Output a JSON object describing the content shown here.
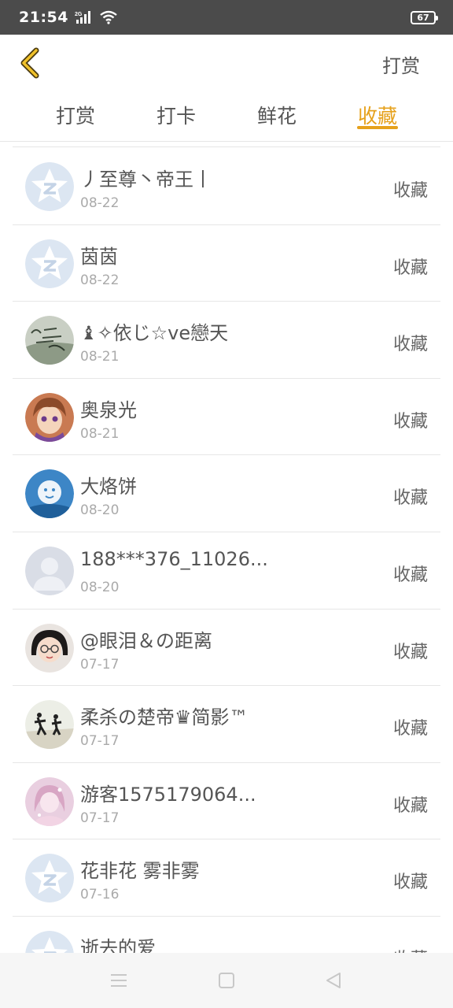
{
  "status_bar": {
    "time": "21:54",
    "network": "2G",
    "battery": "67"
  },
  "header": {
    "back_icon": "chevron-left-icon",
    "action_label": "打赏",
    "accent_color": "#e6a11c"
  },
  "tabs": [
    {
      "label": "打赏",
      "active": false
    },
    {
      "label": "打卡",
      "active": false
    },
    {
      "label": "鲜花",
      "active": false
    },
    {
      "label": "收藏",
      "active": true
    }
  ],
  "rows": [
    {
      "name": "丿至尊丶帝王丨",
      "date": "08-22",
      "action": "收藏",
      "avatar": "default-qq"
    },
    {
      "name": "茵茵",
      "date": "08-22",
      "action": "收藏",
      "avatar": "default-qq"
    },
    {
      "name": "♝✧依じ☆ve戀天",
      "date": "08-21",
      "action": "收藏",
      "avatar": "handwriting"
    },
    {
      "name": "奥泉光",
      "date": "08-21",
      "action": "收藏",
      "avatar": "anime-girl"
    },
    {
      "name": "大烙饼",
      "date": "08-20",
      "action": "收藏",
      "avatar": "blue-moon"
    },
    {
      "name": "188***376_11026...",
      "date": "08-20",
      "action": "收藏",
      "avatar": "default-person"
    },
    {
      "name": "@眼泪＆の距离",
      "date": "07-17",
      "action": "收藏",
      "avatar": "glasses-girl"
    },
    {
      "name": "柔杀の楚帝♛简影™",
      "date": "07-17",
      "action": "收藏",
      "avatar": "beach-people"
    },
    {
      "name": "游客1575179064...",
      "date": "07-17",
      "action": "收藏",
      "avatar": "pink-girl"
    },
    {
      "name": "花非花 雾非雾",
      "date": "07-16",
      "action": "收藏",
      "avatar": "default-qq"
    },
    {
      "name": "逝去的爱",
      "date": "",
      "action": "收藏",
      "avatar": "default-qq"
    }
  ],
  "nav_bar": {
    "icons": [
      "menu-icon",
      "home-square-icon",
      "back-triangle-icon"
    ]
  }
}
